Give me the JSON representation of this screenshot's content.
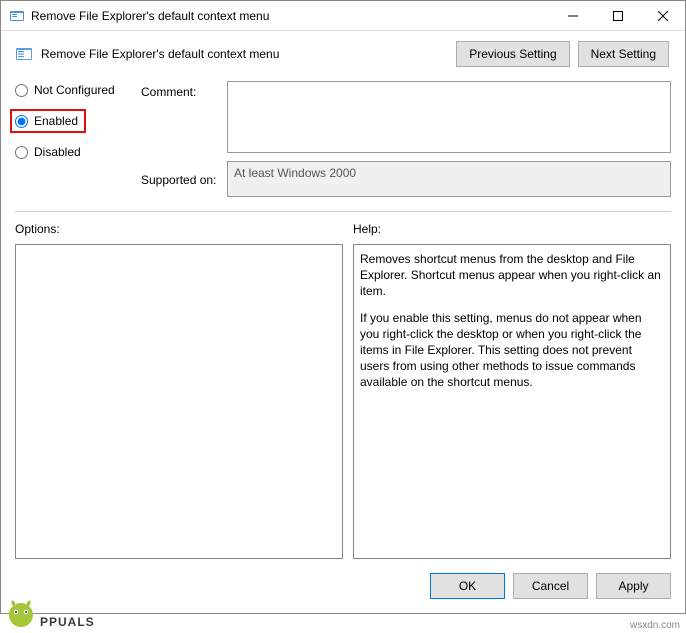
{
  "window": {
    "title": "Remove File Explorer's default context menu"
  },
  "header": {
    "policy_title": "Remove File Explorer's default context menu",
    "previous_setting": "Previous Setting",
    "next_setting": "Next Setting"
  },
  "radios": {
    "not_configured": "Not Configured",
    "enabled": "Enabled",
    "disabled": "Disabled",
    "selected": "enabled"
  },
  "labels": {
    "comment": "Comment:",
    "supported_on": "Supported on:",
    "options": "Options:",
    "help": "Help:"
  },
  "fields": {
    "comment_value": "",
    "supported_on_value": "At least Windows 2000"
  },
  "help": {
    "p1": "Removes shortcut menus from the desktop and File Explorer. Shortcut menus appear when you right-click an item.",
    "p2": "If you enable this setting, menus do not appear when you right-click the desktop or when you right-click the items in File Explorer. This setting does not prevent users from using other methods to issue commands available on the shortcut menus."
  },
  "buttons": {
    "ok": "OK",
    "cancel": "Cancel",
    "apply": "Apply"
  },
  "footer": {
    "watermark": "wsxdn.com",
    "brand": "PPUALS"
  }
}
